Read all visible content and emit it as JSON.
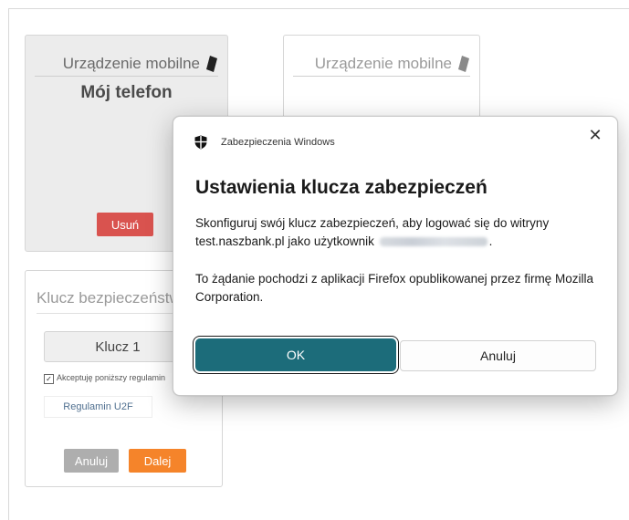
{
  "colors": {
    "remove_button": "#d9534f",
    "next_button": "#f5842a",
    "cancel_button_small": "#aeaeae",
    "dialog_ok": "#1c6c7a"
  },
  "mobile_card_1": {
    "header": "Urządzenie mobilne",
    "icon": "phone-icon",
    "device_name": "Mój telefon",
    "remove_label": "Usuń"
  },
  "mobile_card_2": {
    "header": "Urządzenie mobilne",
    "icon": "phone-icon"
  },
  "key_card": {
    "header": "Klucz bezpieczeństwa",
    "key_value": "Klucz 1",
    "terms_checkbox_label": "Akceptuję poniższy regulamin",
    "terms_checked": true,
    "terms_link": "Regulamin U2F",
    "cancel_label": "Anuluj",
    "next_label": "Dalej"
  },
  "dialog": {
    "app_name": "Zabezpieczenia Windows",
    "app_icon": "shield-icon",
    "close_icon": "close-icon",
    "title": "Ustawienia klucza zabezpieczeń",
    "body_before": "Skonfiguruj swój klucz zabezpieczeń, aby logować się do witryny test.naszbank.pl jako użytkownik",
    "body_after": ".",
    "origin_text": "To żądanie pochodzi z aplikacji Firefox opublikowanej przez firmę Mozilla Corporation.",
    "ok_label": "OK",
    "cancel_label": "Anuluj"
  }
}
